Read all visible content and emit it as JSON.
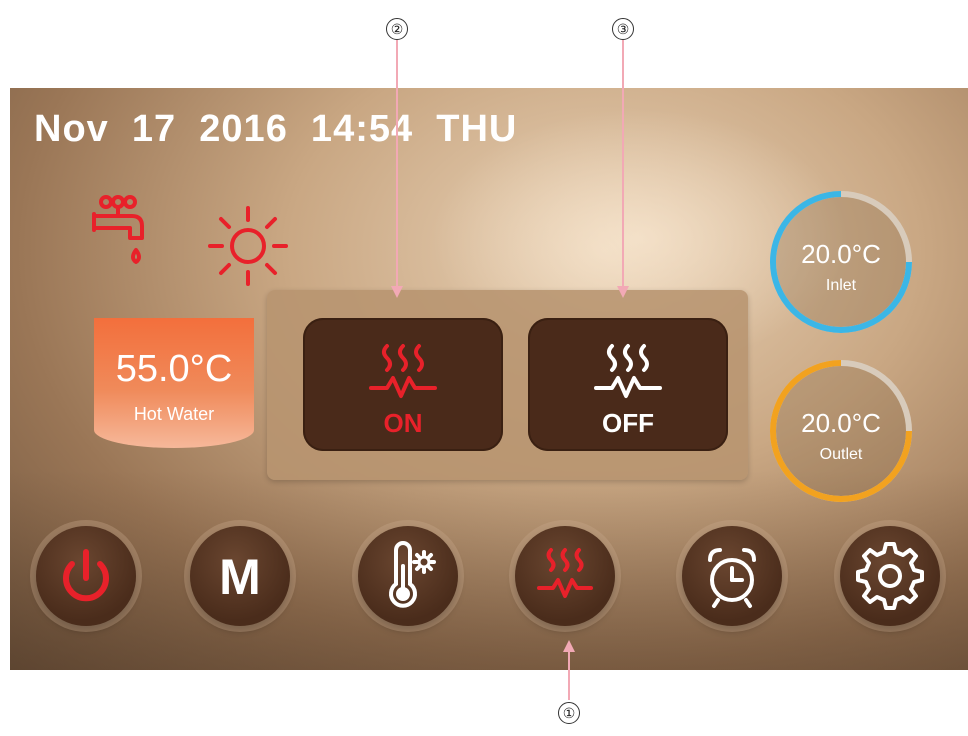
{
  "header": {
    "date": "Nov  17  2016  14:54  THU"
  },
  "status_icons": [
    "faucet-icon",
    "sun-icon"
  ],
  "hot_water": {
    "value": "55.0°C",
    "label": "Hot Water"
  },
  "heater_panel": {
    "on_button": {
      "label": "ON",
      "icon": "heater-icon",
      "color": "#e8212a"
    },
    "off_button": {
      "label": "OFF",
      "icon": "heater-icon",
      "color": "#ffffff"
    }
  },
  "gauges": {
    "inlet": {
      "value": "20.0°C",
      "label": "Inlet",
      "color": "#3bb6e6"
    },
    "outlet": {
      "value": "20.0°C",
      "label": "Outlet",
      "color": "#f2a21f"
    }
  },
  "toolbar": {
    "power_icon": "power-icon",
    "mode_label": "M",
    "temp_settings_icon": "thermometer-gear-icon",
    "heater_icon": "heater-icon",
    "timer_icon": "alarm-clock-icon",
    "settings_icon": "gear-icon"
  },
  "callouts": [
    "①",
    "②",
    "③"
  ],
  "colors": {
    "accent_red": "#e8212a",
    "hot_water_orange": "#f36f3c",
    "inlet_blue": "#3bb6e6",
    "outlet_orange": "#f2a21f"
  }
}
